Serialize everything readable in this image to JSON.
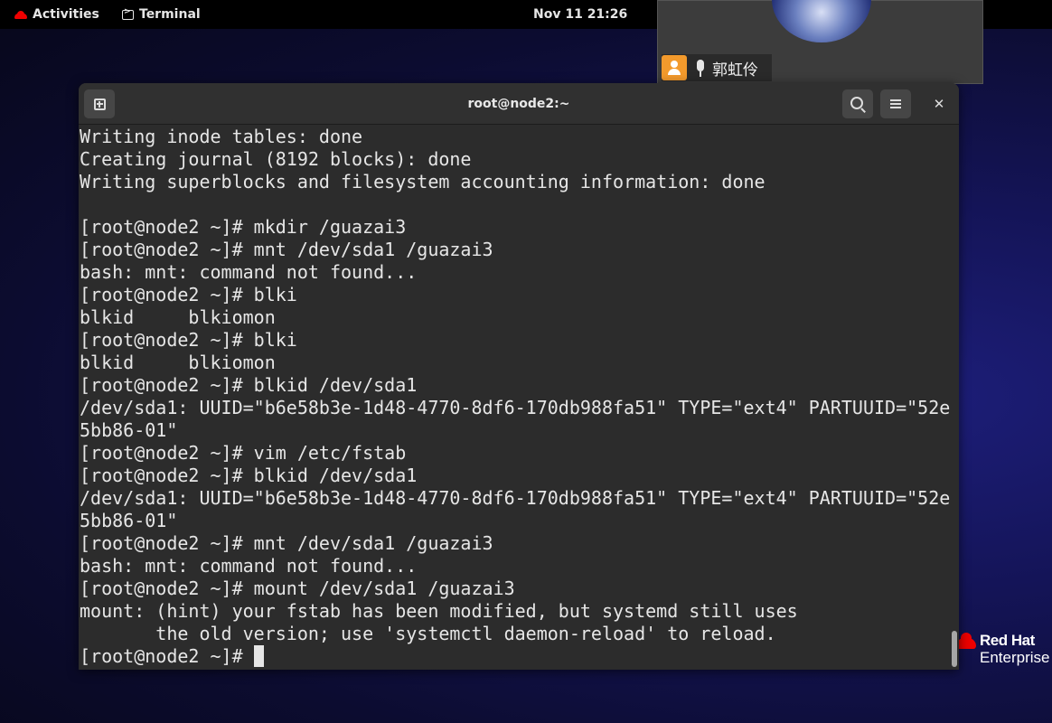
{
  "topbar": {
    "activities_label": "Activities",
    "app_label": "Terminal",
    "clock": "Nov 11  21:26"
  },
  "video_call": {
    "participant_name": "郭虹伶"
  },
  "desktop": {
    "brand_title": "Red Hat",
    "brand_subtitle": "Enterprise"
  },
  "terminal": {
    "title": "root@node2:~",
    "lines": [
      "Writing inode tables: done",
      "Creating journal (8192 blocks): done",
      "Writing superblocks and filesystem accounting information: done",
      "",
      "[root@node2 ~]# mkdir /guazai3",
      "[root@node2 ~]# mnt /dev/sda1 /guazai3",
      "bash: mnt: command not found...",
      "[root@node2 ~]# blki",
      "blkid     blkiomon",
      "[root@node2 ~]# blki",
      "blkid     blkiomon",
      "[root@node2 ~]# blkid /dev/sda1",
      "/dev/sda1: UUID=\"b6e58b3e-1d48-4770-8df6-170db988fa51\" TYPE=\"ext4\" PARTUUID=\"52e",
      "5bb86-01\"",
      "[root@node2 ~]# vim /etc/fstab",
      "[root@node2 ~]# blkid /dev/sda1",
      "/dev/sda1: UUID=\"b6e58b3e-1d48-4770-8df6-170db988fa51\" TYPE=\"ext4\" PARTUUID=\"52e",
      "5bb86-01\"",
      "[root@node2 ~]# mnt /dev/sda1 /guazai3",
      "bash: mnt: command not found...",
      "[root@node2 ~]# mount /dev/sda1 /guazai3",
      "mount: (hint) your fstab has been modified, but systemd still uses",
      "       the old version; use 'systemctl daemon-reload' to reload."
    ],
    "prompt": "[root@node2 ~]# "
  },
  "icons": {
    "activities": "redhat-icon",
    "terminal": "terminal-icon",
    "new_tab": "new-tab-icon",
    "search": "search-icon",
    "menu": "hamburger-menu-icon",
    "close": "close-icon"
  },
  "colors": {
    "terminal_bg": "#2c2c2c",
    "terminal_fg": "#e6e6e6",
    "topbar_bg": "#000000",
    "brand_red": "#ee0000"
  }
}
